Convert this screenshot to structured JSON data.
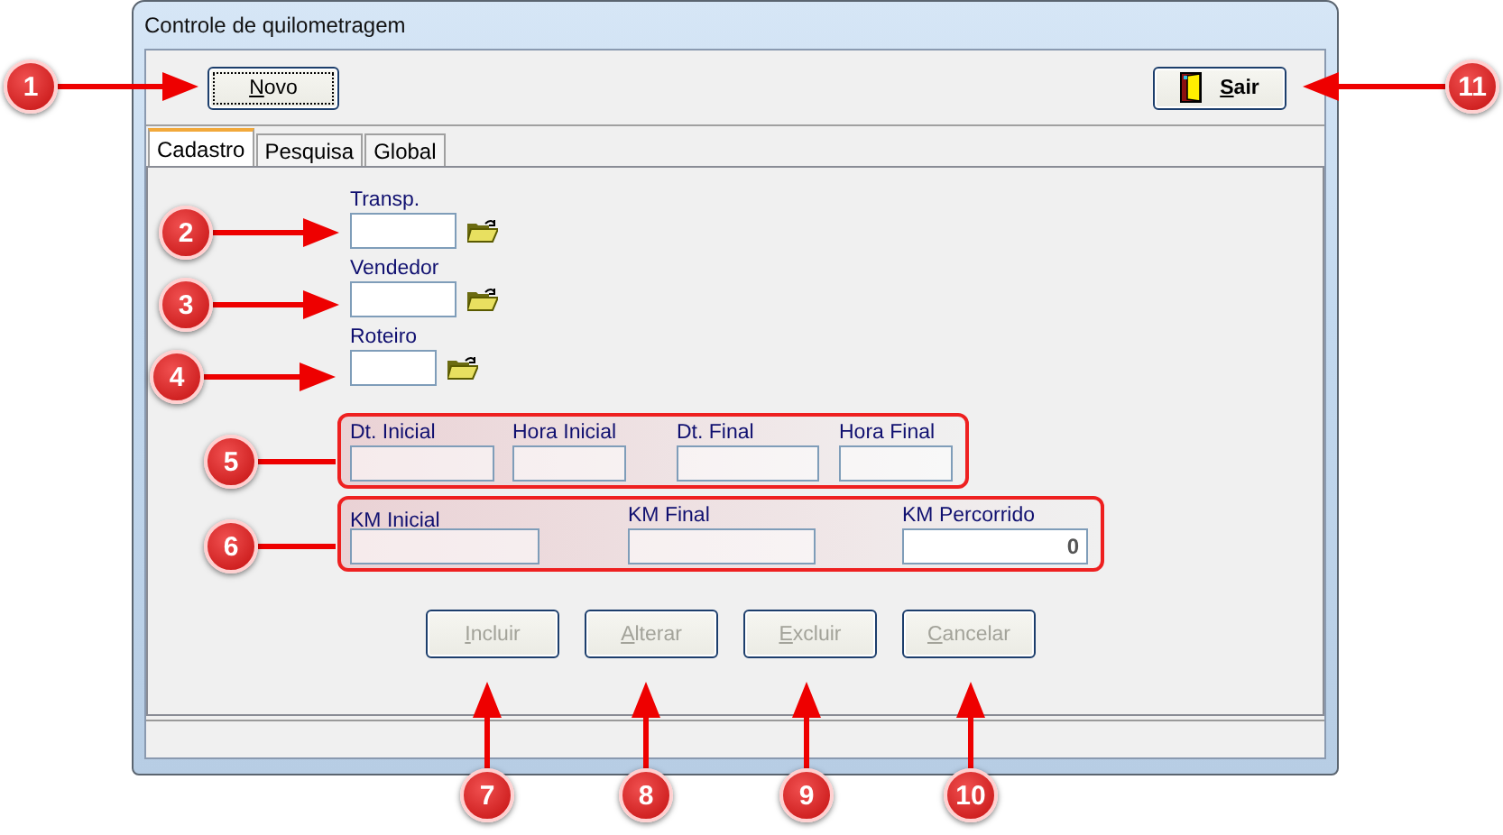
{
  "window": {
    "title": "Controle de quilometragem"
  },
  "toolbar": [
    {
      "kind": "new",
      "key": "N",
      "rest": "ovo"
    },
    {
      "kind": "exit",
      "key": "S",
      "rest": "air"
    }
  ],
  "tabs": [
    {
      "label": "Cadastro",
      "selected": true
    },
    {
      "label": "Pesquisa",
      "selected": false
    },
    {
      "label": "Global",
      "selected": false
    }
  ],
  "lookups": [
    {
      "label": "Transp.",
      "kind": "wide"
    },
    {
      "label": "Vendedor",
      "kind": "wide"
    },
    {
      "label": "Roteiro",
      "kind": "short"
    }
  ],
  "period": [
    {
      "label": "Dt. Inicial"
    },
    {
      "label": "Hora Inicial"
    },
    {
      "label": "Dt. Final"
    },
    {
      "label": "Hora Final"
    }
  ],
  "distance": [
    {
      "label": "KM Inicial"
    },
    {
      "label": "KM Final"
    },
    {
      "label": "KM Percorrido",
      "value": "0"
    }
  ],
  "actions": [
    {
      "key": "I",
      "rest": "ncluir",
      "disabled": true
    },
    {
      "key": "A",
      "rest": "lterar",
      "disabled": true
    },
    {
      "key": "E",
      "rest": "xcluir",
      "disabled": true
    },
    {
      "key": "C",
      "rest": "ancelar",
      "disabled": true
    }
  ],
  "callouts": [
    {
      "number": "1"
    },
    {
      "number": "2"
    },
    {
      "number": "3"
    },
    {
      "number": "4"
    },
    {
      "number": "5"
    },
    {
      "number": "6"
    },
    {
      "number": "7"
    },
    {
      "number": "8"
    },
    {
      "number": "9"
    },
    {
      "number": "10"
    },
    {
      "number": "11"
    }
  ]
}
